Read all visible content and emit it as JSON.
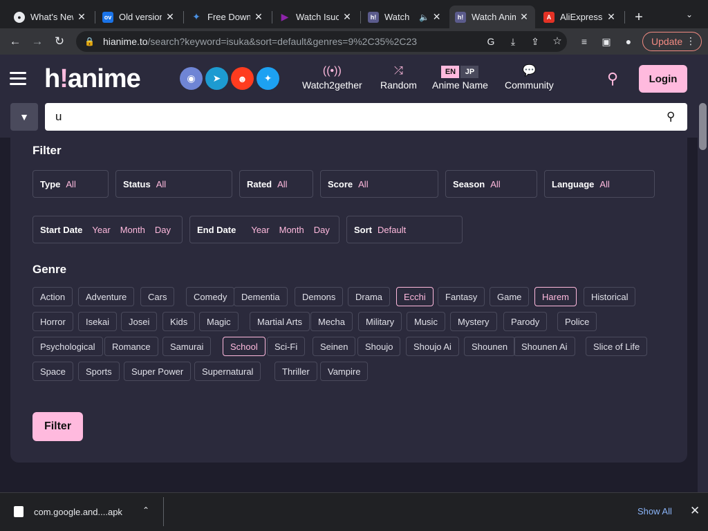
{
  "browser": {
    "tabs": [
      {
        "title": "What's New",
        "favicon": "chrome"
      },
      {
        "title": "Old version",
        "favicon": "ov"
      },
      {
        "title": "Free Downl",
        "favicon": "download"
      },
      {
        "title": "Watch Isuc",
        "favicon": "play"
      },
      {
        "title": "Watch",
        "favicon": "h!"
      },
      {
        "title": "Watch Anim",
        "favicon": "h!"
      },
      {
        "title": "AliExpress",
        "favicon": "aliexpress"
      }
    ],
    "address": {
      "host": "hianime.to",
      "path": "/search?keyword=isuka&sort=default&genres=9%2C35%2C23"
    },
    "update_label": "Update"
  },
  "site": {
    "logo_left": "h",
    "logo_bang": "!",
    "logo_right": "anime",
    "nav": [
      {
        "label": "Watch2gether",
        "icon": "broadcast-icon"
      },
      {
        "label": "Random",
        "icon": "shuffle-icon"
      },
      {
        "label": "Anime Name",
        "icon": "lang-toggle"
      },
      {
        "label": "Community",
        "icon": "chat-icon"
      }
    ],
    "lang": {
      "en": "EN",
      "jp": "JP"
    },
    "login_label": "Login",
    "search_value": "u"
  },
  "filter": {
    "title": "Filter",
    "row1": [
      {
        "label": "Type",
        "value": "All"
      },
      {
        "label": "Status",
        "value": "All"
      },
      {
        "label": "Rated",
        "value": "All"
      },
      {
        "label": "Score",
        "value": "All"
      },
      {
        "label": "Season",
        "value": "All"
      },
      {
        "label": "Language",
        "value": "All"
      }
    ],
    "start_date": {
      "label": "Start Date",
      "year": "Year",
      "month": "Month",
      "day": "Day"
    },
    "end_date": {
      "label": "End Date",
      "year": "Year",
      "month": "Month",
      "day": "Day"
    },
    "sort": {
      "label": "Sort",
      "value": "Default"
    },
    "genre_title": "Genre",
    "genres": [
      [
        "Action",
        "Adventure",
        "Cars",
        "Comedy",
        "Dementia",
        "Demons",
        "Drama",
        "Ecchi",
        "Fantasy",
        "Game",
        "Harem",
        "Historical"
      ],
      [
        "Horror",
        "Isekai",
        "Josei",
        "Kids",
        "Magic",
        "Martial Arts",
        "Mecha",
        "Military",
        "Music",
        "Mystery",
        "Parody",
        "Police"
      ],
      [
        "Psychological",
        "Romance",
        "Samurai",
        "School",
        "Sci-Fi",
        "Seinen",
        "Shoujo",
        "Shoujo Ai",
        "Shounen",
        "Shounen Ai",
        "Slice of Life"
      ],
      [
        "Space",
        "Sports",
        "Super Power",
        "Supernatural",
        "Thriller",
        "Vampire"
      ]
    ],
    "selected_genres": [
      "Ecchi",
      "Harem",
      "School"
    ],
    "submit_label": "Filter"
  },
  "downloads": {
    "file": "com.google.and....apk",
    "show_all": "Show All"
  },
  "colors": {
    "accent": "#ffbade",
    "bg": "#2b2a3c"
  }
}
